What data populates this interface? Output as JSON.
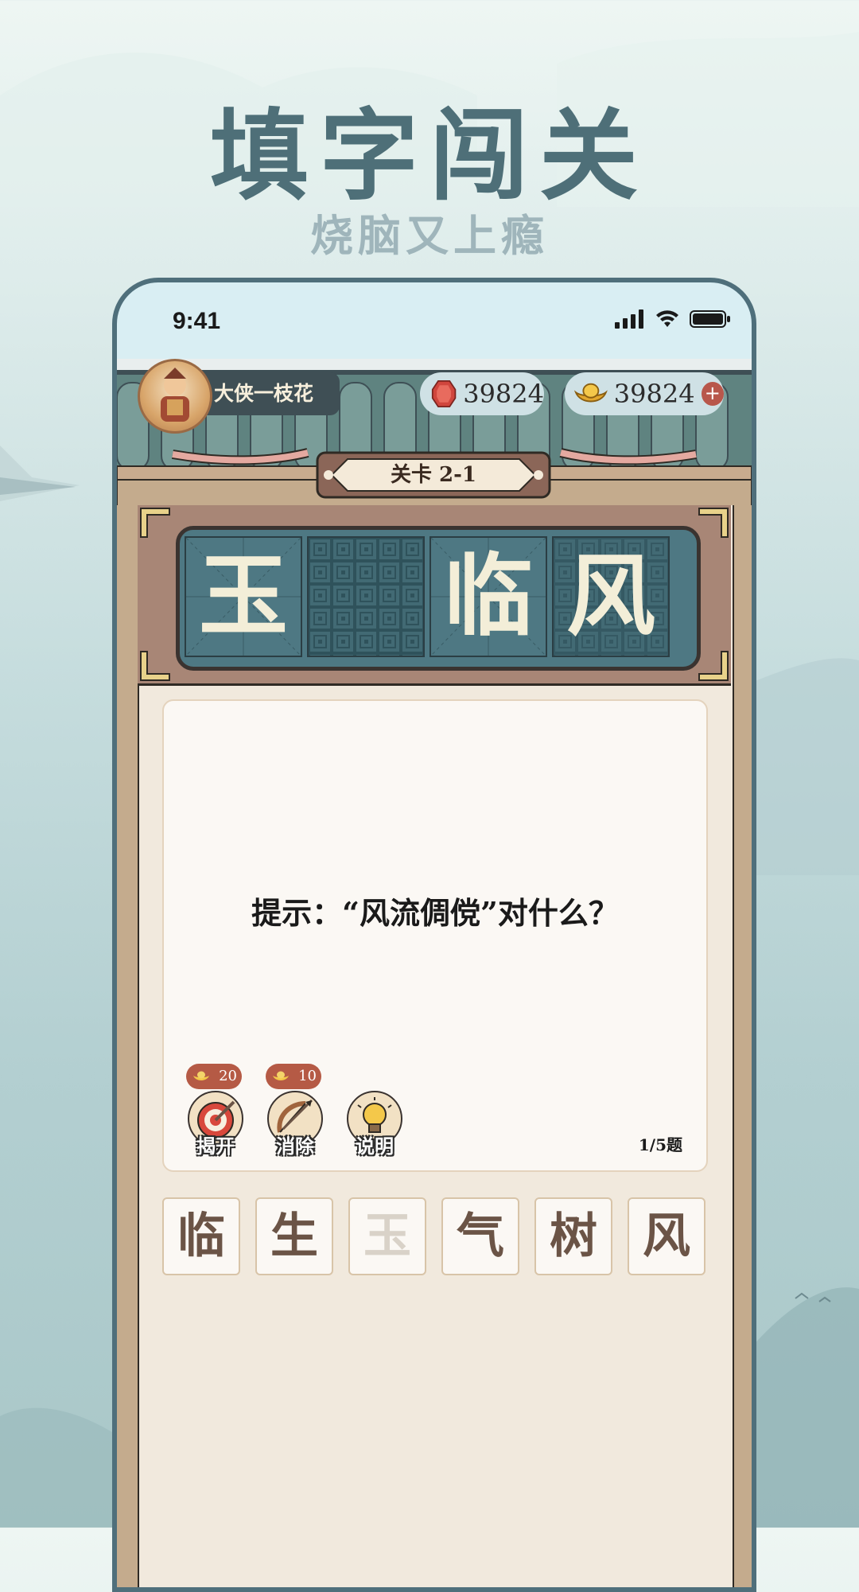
{
  "promo": {
    "title": "填字闯关",
    "subtitle": "烧脑又上瘾"
  },
  "status_bar": {
    "time": "9:41",
    "icons": [
      "signal-icon",
      "wifi-icon",
      "battery-icon"
    ]
  },
  "profile": {
    "nickname": "大侠一枝花",
    "avatar": "warrior-avatar"
  },
  "currency": {
    "gems": "39824",
    "gold": "39824",
    "gem_icon": "ruby-gem-icon",
    "gold_icon": "gold-ingot-icon",
    "add_label": "+"
  },
  "level": {
    "label": "关卡 2-1"
  },
  "board": {
    "cells": [
      {
        "char": "玉",
        "filled": true
      },
      {
        "char": "",
        "filled": false
      },
      {
        "char": "临",
        "filled": true
      },
      {
        "char": "风",
        "filled": true
      }
    ]
  },
  "hint": {
    "text": "提示：“风流倜傥”对什么？",
    "progress": "1/5题"
  },
  "tools": [
    {
      "label": "揭开",
      "cost": "20",
      "icon": "target-icon"
    },
    {
      "label": "消除",
      "cost": "10",
      "icon": "bow-arrow-icon"
    },
    {
      "label": "说明",
      "cost": "",
      "icon": "lightbulb-icon"
    }
  ],
  "options": [
    {
      "char": "临",
      "used": false
    },
    {
      "char": "生",
      "used": false
    },
    {
      "char": "玉",
      "used": true
    },
    {
      "char": "气",
      "used": false
    },
    {
      "char": "树",
      "used": false
    },
    {
      "char": "风",
      "used": false
    }
  ],
  "colors": {
    "headline": "#4e6f78",
    "board": "#4e7883",
    "frame": "#a88676",
    "accent_red": "#b55a45"
  }
}
